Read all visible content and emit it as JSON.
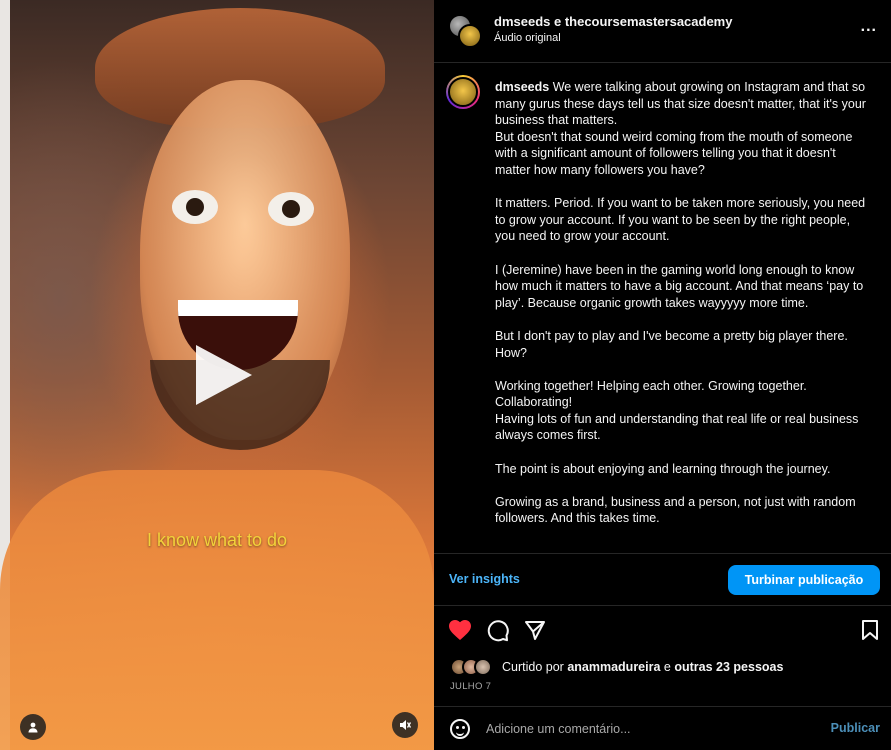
{
  "video": {
    "caption_text": "I know what to do",
    "icons": {
      "play": "play-icon",
      "profile": "user-icon",
      "mute": "muted-speaker-icon"
    }
  },
  "post": {
    "header": {
      "title": "dmseeds e thecoursemastersacademy",
      "subtitle": "Áudio original",
      "more_label": "..."
    },
    "caption": {
      "username": "dmseeds",
      "paragraphs": [
        "We were talking about growing on Instagram and that so many gurus these days tell us that size doesn't matter, that it's your business that matters.",
        "But doesn't that sound weird coming from the mouth of someone with a significant amount of followers telling you that it doesn't matter how many followers you have?",
        "",
        "It matters. Period. If you want to be taken more seriously, you need to grow your account. If you want to be seen by the right people, you need to grow your account.",
        "",
        "I (Jeremine) have been in the gaming world long enough to know how much it matters to have a big account. And that means ‘pay to play’. Because organic growth takes wayyyyy more time.",
        "",
        "But I don't pay to play and I've become a pretty big player there. How?",
        "",
        "Working together! Helping each other. Growing together. Collaborating!",
        "Having lots of fun and understanding that real life or real business always comes first.",
        "",
        "The point is about enjoying and learning through the journey.",
        "",
        "Growing as a brand, business and a person, not just with random followers. And this takes time."
      ]
    },
    "insights_label": "Ver insights",
    "boost_label": "Turbinar publicação",
    "actions": {
      "like": "heart-icon",
      "comment": "comment-icon",
      "share": "send-icon",
      "save": "bookmark-icon",
      "liked": true
    },
    "likes": {
      "prefix": "Curtido por",
      "user": "anammadureira",
      "joiner": "e",
      "others": "outras 23 pessoas"
    },
    "date": "JULHO 7",
    "comment": {
      "placeholder": "Adicione um comentário...",
      "post_label": "Publicar"
    }
  },
  "colors": {
    "accent": "#0095f6",
    "link": "#4cb5f9",
    "like": "#ff3040",
    "caption_yellow": "#f2d23a"
  }
}
